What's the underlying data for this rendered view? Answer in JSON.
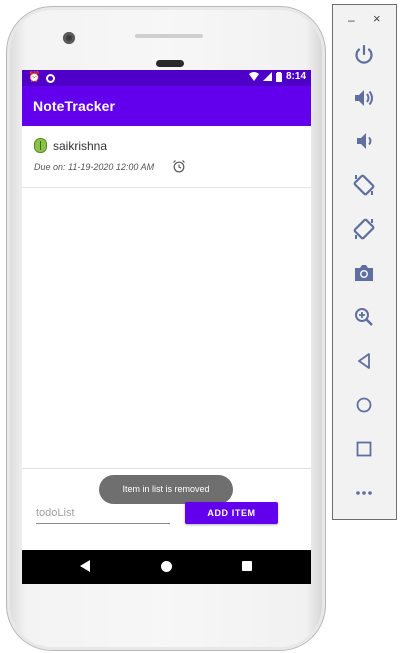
{
  "status_bar": {
    "time": "8:14",
    "left_icons": [
      "alarm-icon",
      "sync-icon"
    ],
    "right_icons": [
      "wifi-icon",
      "signal-icon",
      "battery-icon"
    ]
  },
  "app_bar": {
    "title": "NoteTracker"
  },
  "list": {
    "items": [
      {
        "title": "saikrishna",
        "due": "Due on: 11-19-2020 12:00 AM",
        "icon": "alarm-clock-icon"
      }
    ]
  },
  "toast": {
    "message": "Item in list is removed"
  },
  "input": {
    "placeholder": "todoList"
  },
  "add_button": {
    "label": "ADD ITEM"
  },
  "nav_bar": {
    "buttons": [
      "back-icon",
      "home-icon",
      "recents-icon"
    ]
  },
  "emulator_panel": {
    "window_controls": {
      "minimize": "–",
      "close": "×"
    },
    "tools": [
      "power-icon",
      "volume-up-icon",
      "volume-down-icon",
      "rotate-left-icon",
      "rotate-right-icon",
      "camera-icon",
      "zoom-icon",
      "back-icon",
      "home-icon",
      "overview-icon",
      "more-icon"
    ]
  },
  "colors": {
    "status_bar": "#4f00c8",
    "app_bar": "#6200ee",
    "button": "#6200ee",
    "toast": "#6f6f6f",
    "panel_icons": "#5f6fa0"
  }
}
